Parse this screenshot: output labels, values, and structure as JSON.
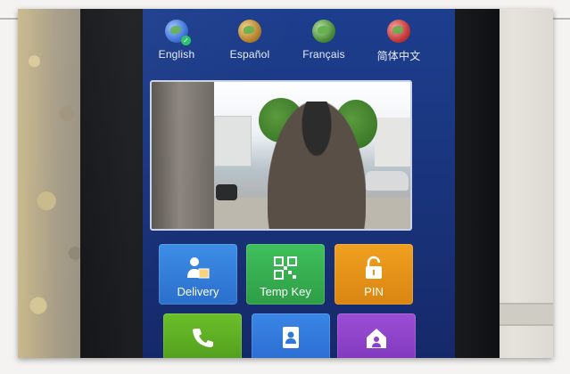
{
  "languages": [
    {
      "label": "English",
      "icon": "globe-icon",
      "selected": true
    },
    {
      "label": "Español",
      "icon": "globe-icon",
      "selected": false
    },
    {
      "label": "Français",
      "icon": "globe-icon",
      "selected": false
    },
    {
      "label": "简体中文",
      "icon": "globe-icon",
      "selected": false
    }
  ],
  "camera": {
    "icon": "camera-preview"
  },
  "tiles": [
    {
      "label": "Delivery",
      "icon": "delivery-icon",
      "color": "#2f7bd9"
    },
    {
      "label": "Temp Key",
      "icon": "qr-code-icon",
      "color": "#35ae50"
    },
    {
      "label": "PIN",
      "icon": "lock-icon",
      "color": "#e3931a"
    },
    {
      "icon": "phone-call-icon",
      "color": "#5da622"
    },
    {
      "icon": "contacts-icon",
      "color": "#2f78db"
    },
    {
      "icon": "home-user-icon",
      "color": "#8c42c8"
    }
  ]
}
